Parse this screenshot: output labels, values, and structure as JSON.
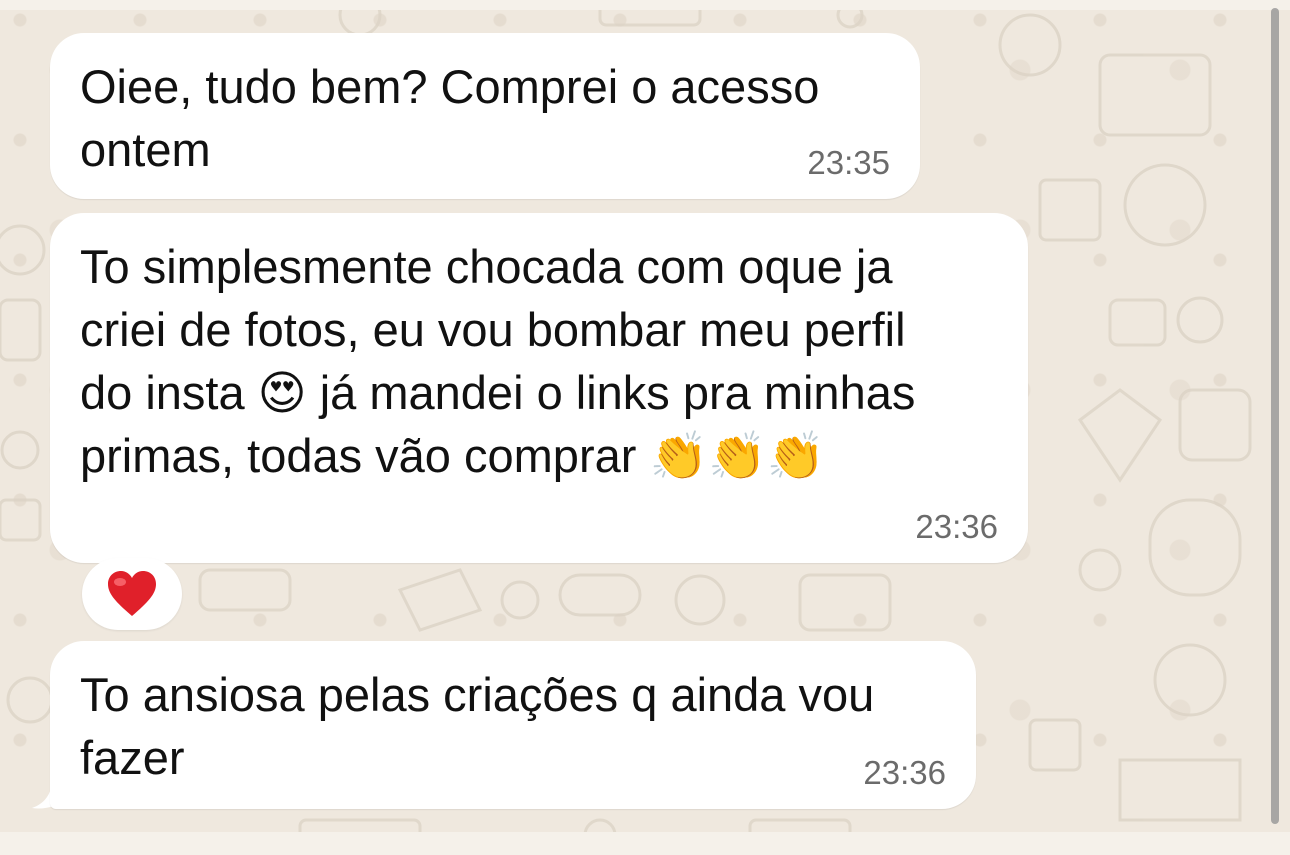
{
  "messages": [
    {
      "text": "Oiee, tudo bem? Comprei o acesso\nontem",
      "time": "23:35"
    },
    {
      "text": "To simplesmente chocada com oque ja\ncriei de fotos, eu vou bombar meu perfil\ndo insta 😍 já mandei o links pra minhas\nprimas, todas vão comprar 👏👏👏",
      "time": "23:36"
    },
    {
      "text": "To ansiosa pelas criações q ainda vou\nfazer",
      "time": "23:36"
    }
  ],
  "reaction": {
    "emoji": "❤️",
    "icon": "heart-icon"
  },
  "colors": {
    "bubble": "#ffffff",
    "background": "#efe8de",
    "time": "#6b6b6b",
    "heart": "#e0202a"
  }
}
